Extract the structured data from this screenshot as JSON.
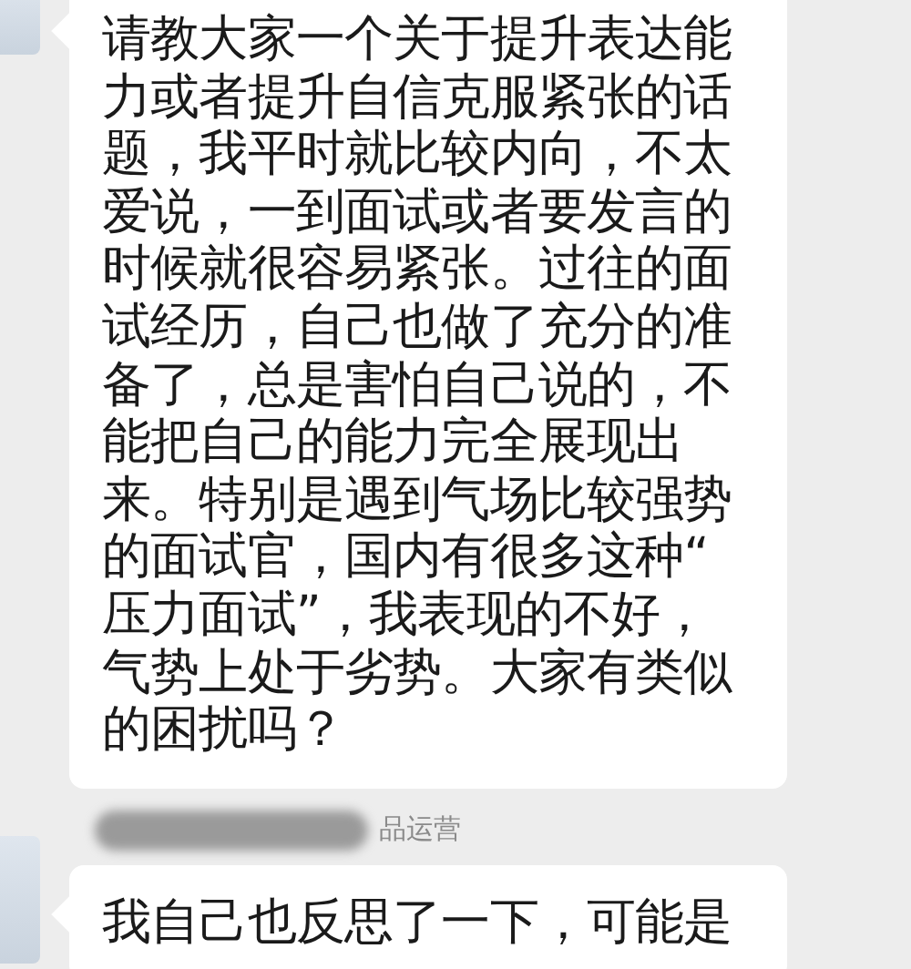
{
  "messages": [
    {
      "lines": [
        "请教大家一个关于提升表达能",
        "力或者提升自信克服紧张的话",
        "题，我平时就比较内向，不太",
        "爱说，一到面试或者要发言的",
        "时候就很容易紧张。过往的面",
        "试经历，自己也做了充分的准",
        "备了，总是害怕自己说的，不",
        "能把自己的能力完全展现出",
        "来。特别是遇到气场比较强势",
        "的面试官，国内有很多这种“",
        "压力面试”，我表现的不好，",
        "气势上处于劣势。大家有类似",
        "的困扰吗？"
      ]
    },
    {
      "sender": "品运营",
      "lines": [
        "我自己也反思了一下，可能是"
      ]
    }
  ]
}
